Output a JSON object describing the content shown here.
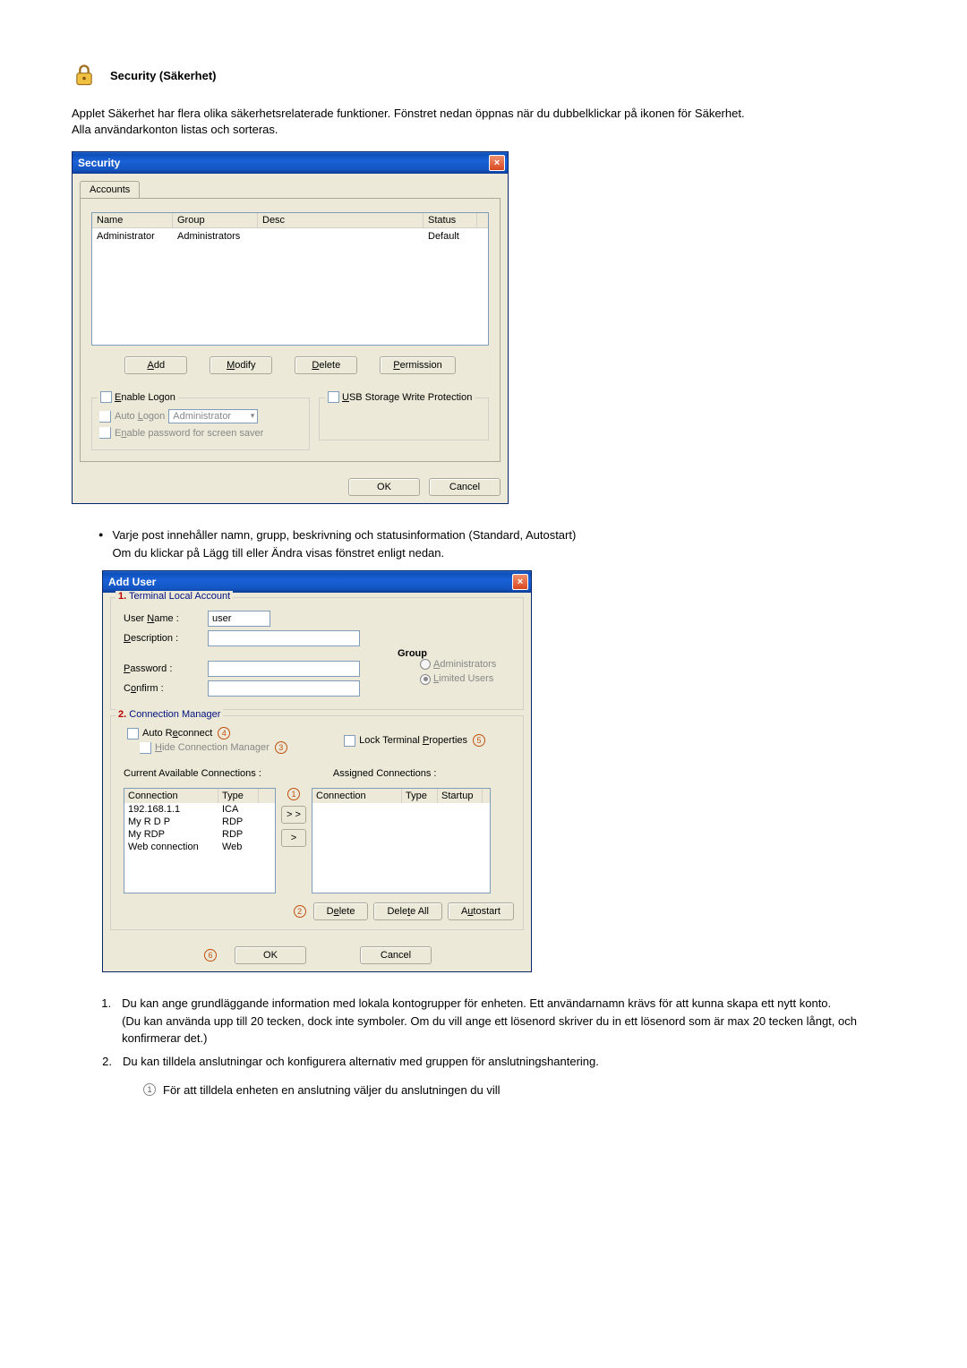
{
  "header": {
    "title": "Security (Säkerhet)"
  },
  "intro": {
    "line1": "Applet Säkerhet har flera olika säkerhetsrelaterade funktioner. Fönstret nedan öppnas när du dubbelklickar på ikonen för Säkerhet.",
    "line2": "Alla användarkonton listas och sorteras."
  },
  "security_dialog": {
    "title": "Security",
    "tab": "Accounts",
    "columns": {
      "name": "Name",
      "group": "Group",
      "desc": "Desc",
      "status": "Status"
    },
    "row": {
      "name": "Administrator",
      "group": "Administrators",
      "desc": "",
      "status": "Default"
    },
    "buttons": {
      "add": "Add",
      "modify": "Modify",
      "delete": "Delete",
      "permission": "Permission"
    },
    "enable_logon": {
      "label": "Enable Logon",
      "auto_logon": "Auto Logon",
      "auto_logon_value": "Administrator",
      "enable_pw_ss": "Enable password for screen saver"
    },
    "usb": "USB Storage Write Protection",
    "ok": "OK",
    "cancel": "Cancel"
  },
  "bullet": {
    "line1": "Varje post innehåller namn, grupp, beskrivning och statusinformation (Standard, Autostart)",
    "line2": "Om du klickar på Lägg till eller Ändra visas fönstret enligt nedan."
  },
  "adduser": {
    "title": "Add User",
    "tla": {
      "num": "1.",
      "title": "Terminal Local Account",
      "user_name": "User Name :",
      "user_name_value": "user",
      "description": "Description :",
      "password": "Password :",
      "confirm": "Confirm :",
      "group": "Group",
      "admins": "Administrators",
      "limited": "Limited Users"
    },
    "cm": {
      "num": "2.",
      "title": "Connection Manager",
      "auto_reconnect": "Auto Reconnect",
      "hide_cm": "Hide Connection Manager",
      "lock_tp": "Lock Terminal Properties",
      "n3": "3",
      "n4": "4",
      "n5": "5",
      "current_avail": "Current Available Connections :",
      "assigned": "Assigned Connections :",
      "avail_cols": {
        "conn": "Connection",
        "type": "Type"
      },
      "avail_rows": [
        {
          "conn": "192.168.1.1",
          "type": "ICA"
        },
        {
          "conn": "My R D P",
          "type": "RDP"
        },
        {
          "conn": "My RDP",
          "type": "RDP"
        },
        {
          "conn": "Web connection",
          "type": "Web"
        }
      ],
      "asg_cols": {
        "conn": "Connection",
        "type": "Type",
        "startup": "Startup"
      },
      "move1": "> >",
      "move2": ">",
      "n1": "1",
      "n2": "2",
      "delete": "Delete",
      "delete_all": "Delete All",
      "autostart": "Autostart"
    },
    "n6": "6",
    "ok": "OK",
    "cancel": "Cancel"
  },
  "numlist": {
    "item1": "Du kan ange grundläggande information med lokala kontogrupper för enheten. Ett användarnamn krävs för att kunna skapa ett nytt konto.\n(Du kan använda upp till 20 tecken, dock inte symboler. Om du vill ange ett lösenord skriver du in ett lösenord som är max 20 tecken långt, och konfirmerar det.)",
    "item2": "Du kan tilldela anslutningar och konfigurera alternativ med gruppen för anslutningshantering.",
    "subnote_num": "1",
    "subnote": "För att tilldela enheten en anslutning väljer du anslutningen du vill"
  }
}
